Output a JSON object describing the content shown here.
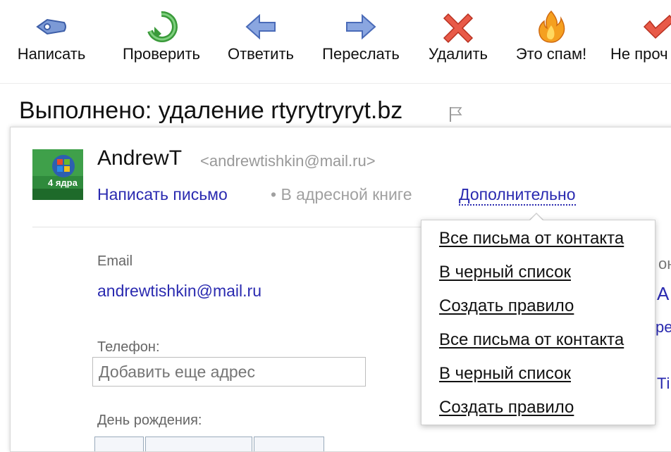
{
  "toolbar": {
    "buttons": [
      {
        "label": "Написать",
        "icon": "pen-icon"
      },
      {
        "label": "Проверить",
        "icon": "refresh-icon"
      },
      {
        "label": "Ответить",
        "icon": "reply-arrow-icon"
      },
      {
        "label": "Переслать",
        "icon": "forward-arrow-icon"
      },
      {
        "label": "Удалить",
        "icon": "delete-x-icon"
      },
      {
        "label": "Это спам!",
        "icon": "flame-icon"
      },
      {
        "label": "Не проч",
        "icon": "checkmark-icon"
      }
    ]
  },
  "message": {
    "title": "Выполнено: удаление rtyrytryryt.bz"
  },
  "contact": {
    "name": "AndrewT",
    "email_header": "<andrewtishkin@mail.ru>",
    "avatar_text": "4 ядра",
    "actions": {
      "write": "Написать письмо",
      "address_book": "• В адресной книге",
      "more": "Дополнительно"
    },
    "fields": {
      "email_label": "Email",
      "email_value": "andrewtishkin@mail.ru",
      "phone_label": "Телефон:",
      "phone_placeholder": "Добавить еще адрес",
      "birthday_label": "День рождения:"
    },
    "right_fragments": [
      "оно",
      "А",
      "ре",
      "Ті"
    ]
  },
  "dropdown": {
    "items": [
      "Все письма от контакта",
      "В черный список",
      "Создать правило",
      "Все письма от контакта",
      "В черный список",
      "Создать правило"
    ]
  },
  "colors": {
    "link": "#2a2ab0",
    "muted": "#a0a0a0",
    "toolbar_blue": "#6f8fd0",
    "refresh_green": "#3a9a3a",
    "delete_red": "#e04a3a",
    "flame_orange": "#f59a1a"
  }
}
